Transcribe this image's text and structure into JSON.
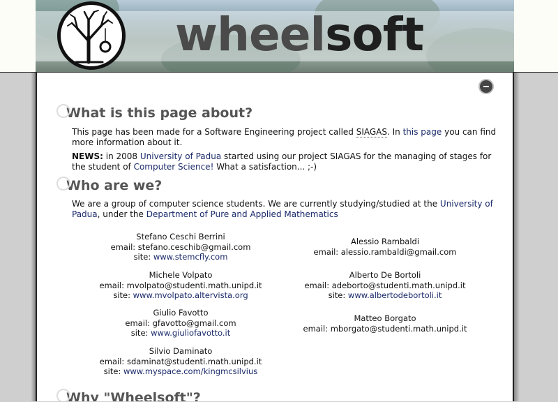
{
  "header": {
    "logo_part1": "wheel",
    "logo_part2": "soft"
  },
  "section1": {
    "title": "What is this page about?",
    "p1_a": "This page has been made for a Software Engineering project called ",
    "p1_siagas": "SIAGAS",
    "p1_b": ". In ",
    "p1_link": "this page",
    "p1_c": " you can find more information about it.",
    "news_label": "NEWS:",
    "news_a": " in 2008 ",
    "news_link1": "University of Padua",
    "news_b": " started using our project SIAGAS for the managing of stages for the student of ",
    "news_link2": "Computer Science!",
    "news_c": " What a satisfaction... ;-)"
  },
  "section2": {
    "title": "Who are we?",
    "p_a": "We are a group of computer science students. We are currently studying/studied at the ",
    "p_link1": "University of Padua",
    "p_b": ", under the ",
    "p_link2": "Department of Pure and Applied Mathematics"
  },
  "people_left": [
    {
      "name": "Stefano Ceschi Berrini",
      "email": "email: stefano.ceschib@gmail.com",
      "site_label": "site: ",
      "site": "www.stemcfly.com"
    },
    {
      "name": "Michele Volpato",
      "email": "email: mvolpato@studenti.math.unipd.it",
      "site_label": "site: ",
      "site": "www.mvolpato.altervista.org"
    },
    {
      "name": "Giulio Favotto",
      "email": "email: gfavotto@gmail.com",
      "site_label": "site: ",
      "site": "www.giuliofavotto.it"
    },
    {
      "name": "Silvio Daminato",
      "email": "email: sdaminat@studenti.math.unipd.it",
      "site_label": "site: ",
      "site": "www.myspace.com/kingmcsilvius"
    }
  ],
  "people_right": [
    {
      "name": "Alessio Rambaldi",
      "email": "email: alessio.rambaldi@gmail.com"
    },
    {
      "name": "Alberto De Bortoli",
      "email": "email: adeborto@studenti.math.unipd.it",
      "site_label": "site: ",
      "site": "www.albertodebortoli.it"
    },
    {
      "name": "Matteo Borgato",
      "email": "email: mborgato@studenti.math.unipd.it"
    }
  ],
  "section3": {
    "title": "Why \"Wheelsoft\"?"
  }
}
